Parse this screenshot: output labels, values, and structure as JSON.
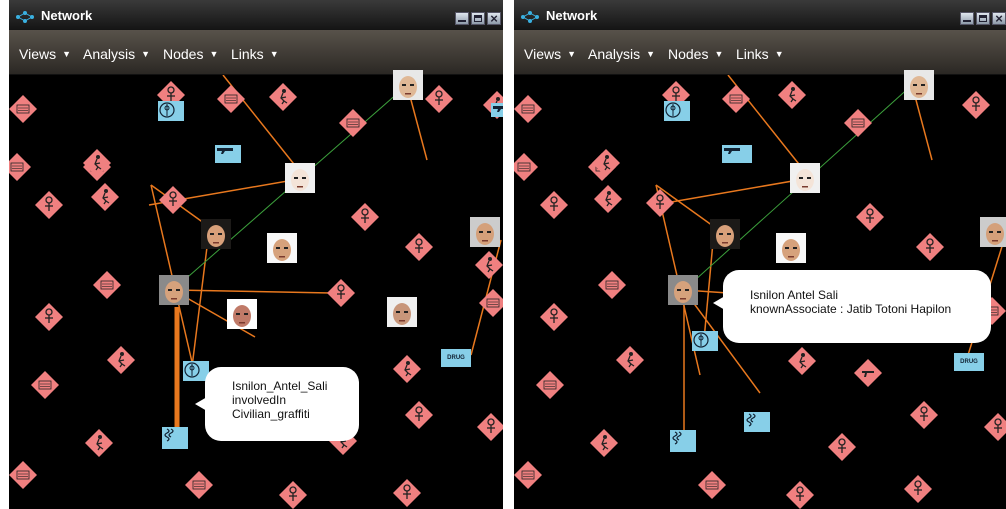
{
  "window_title": "Network",
  "menus": [
    "Views",
    "Analysis",
    "Nodes",
    "Links"
  ],
  "left_panel": {
    "tooltip": {
      "line1": "Isnilon_Antel_Sali",
      "line2": "involvedIn",
      "line3": "Civilian_graffiti"
    }
  },
  "right_panel": {
    "tooltip": {
      "line1": "Isnilon Antel Sali",
      "line2": "knownAssociate : Jatib Totoni Hapilon"
    }
  },
  "drug_label": "DRUG",
  "colors": {
    "node_diamond": "#f08080",
    "node_blue": "#87cfe8",
    "link_orange": "#e8781e",
    "link_green": "#3ca03c"
  }
}
